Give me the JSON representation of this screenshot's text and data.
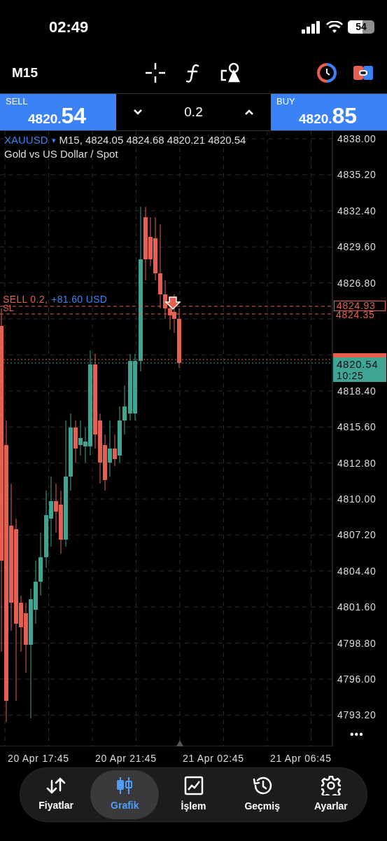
{
  "status_bar": {
    "time": "02:49",
    "battery": "54"
  },
  "toolbar": {
    "timeframe": "M15"
  },
  "trade_panel": {
    "sell": {
      "label": "SELL",
      "price_small": "4820.",
      "price_big": "54"
    },
    "volume": "0.2",
    "buy": {
      "label": "BUY",
      "price_small": "4820.",
      "price_big": "85"
    }
  },
  "chart": {
    "symbol": "XAUUSD",
    "symbol_caret": "▾",
    "quote": "M15, 4824.05 4824.68 4820.21 4820.54",
    "description": "Gold vs US Dollar / Spot",
    "position_label": "SELL 0.2,",
    "profit": "+81.60 USD",
    "sl_label": "SL",
    "price_axis": [
      "4838.00",
      "4835.20",
      "4832.40",
      "4829.60",
      "4826.80",
      "4818.40",
      "4815.60",
      "4812.80",
      "4810.00",
      "4807.20",
      "4804.40",
      "4801.60",
      "4798.80",
      "4796.00",
      "4793.20"
    ],
    "entry_price": "4824.93",
    "sl_price": "4824.35",
    "bid_price": "4820.54",
    "countdown": "10:25",
    "time_axis": [
      "20 Apr 17:45",
      "20 Apr 21:45",
      "21 Apr 02:45",
      "21 Apr 06:45"
    ],
    "more": "•••"
  },
  "nav": [
    {
      "label": "Fiyatlar",
      "selected": false
    },
    {
      "label": "Grafik",
      "selected": true
    },
    {
      "label": "İşlem",
      "selected": false
    },
    {
      "label": "Geçmiş",
      "selected": false
    },
    {
      "label": "Ayarlar",
      "selected": false
    }
  ]
}
